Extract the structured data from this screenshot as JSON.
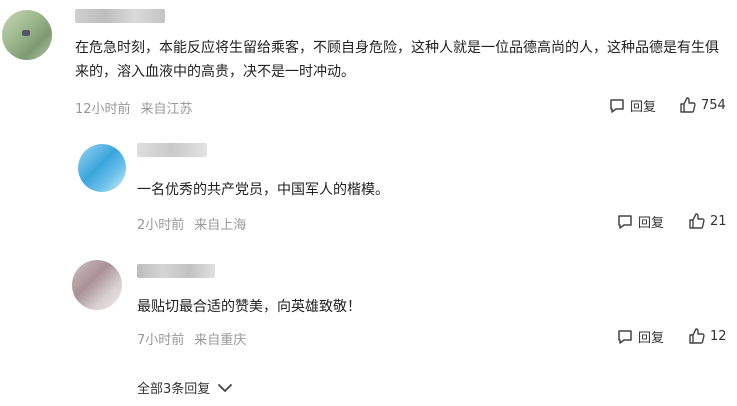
{
  "comments": [
    {
      "text": "在危急时刻，本能反应将生留给乘客，不顾自身危险，这种人就是一位品德高尚的人，这种品德是有生俱来的，溶入血液中的高贵，决不是一时冲动。",
      "time": "12小时前",
      "location": "来自江苏",
      "reply_label": "回复",
      "likes": "754"
    }
  ],
  "replies": [
    {
      "text": "一名优秀的共产党员，中国军人的楷模。",
      "time": "2小时前",
      "location": "来自上海",
      "reply_label": "回复",
      "likes": "21"
    },
    {
      "text": "最贴切最合适的赞美，向英雄致敬！",
      "time": "7小时前",
      "location": "来自重庆",
      "reply_label": "回复",
      "likes": "12"
    }
  ],
  "expand_label": "全部3条回复",
  "icons": {
    "reply": "comment-bubble-icon",
    "like": "thumbs-up-icon",
    "expand": "chevron-down-icon"
  },
  "colors": {
    "meta": "#999999",
    "text": "#222222"
  }
}
